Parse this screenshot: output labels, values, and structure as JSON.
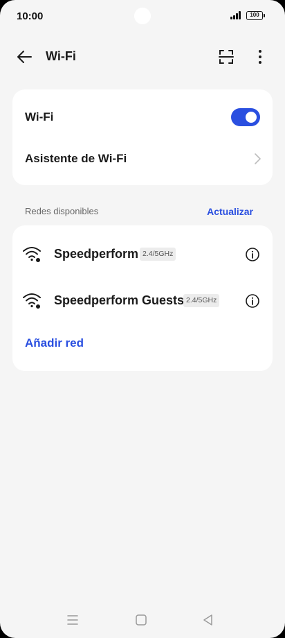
{
  "status_bar": {
    "time": "10:00",
    "battery": "100"
  },
  "header": {
    "title": "Wi-Fi",
    "back_icon": "arrow-left-icon",
    "scan_icon": "qr-scan-icon",
    "more_icon": "more-vertical-icon"
  },
  "wifi_card": {
    "wifi_label": "Wi-Fi",
    "wifi_enabled": true,
    "assistant_label": "Asistente de Wi-Fi"
  },
  "available": {
    "section_label": "Redes disponibles",
    "refresh_label": "Actualizar",
    "networks": [
      {
        "name": "Speedperform",
        "band": "2.4/5GHz",
        "icon": "wifi-icon"
      },
      {
        "name": "Speedperform Guests",
        "band": "2.4/5GHz",
        "icon": "wifi-icon"
      }
    ],
    "add_network_label": "Añadir red"
  },
  "colors": {
    "accent": "#2a4fe0",
    "background": "#f5f5f5",
    "card": "#ffffff"
  }
}
